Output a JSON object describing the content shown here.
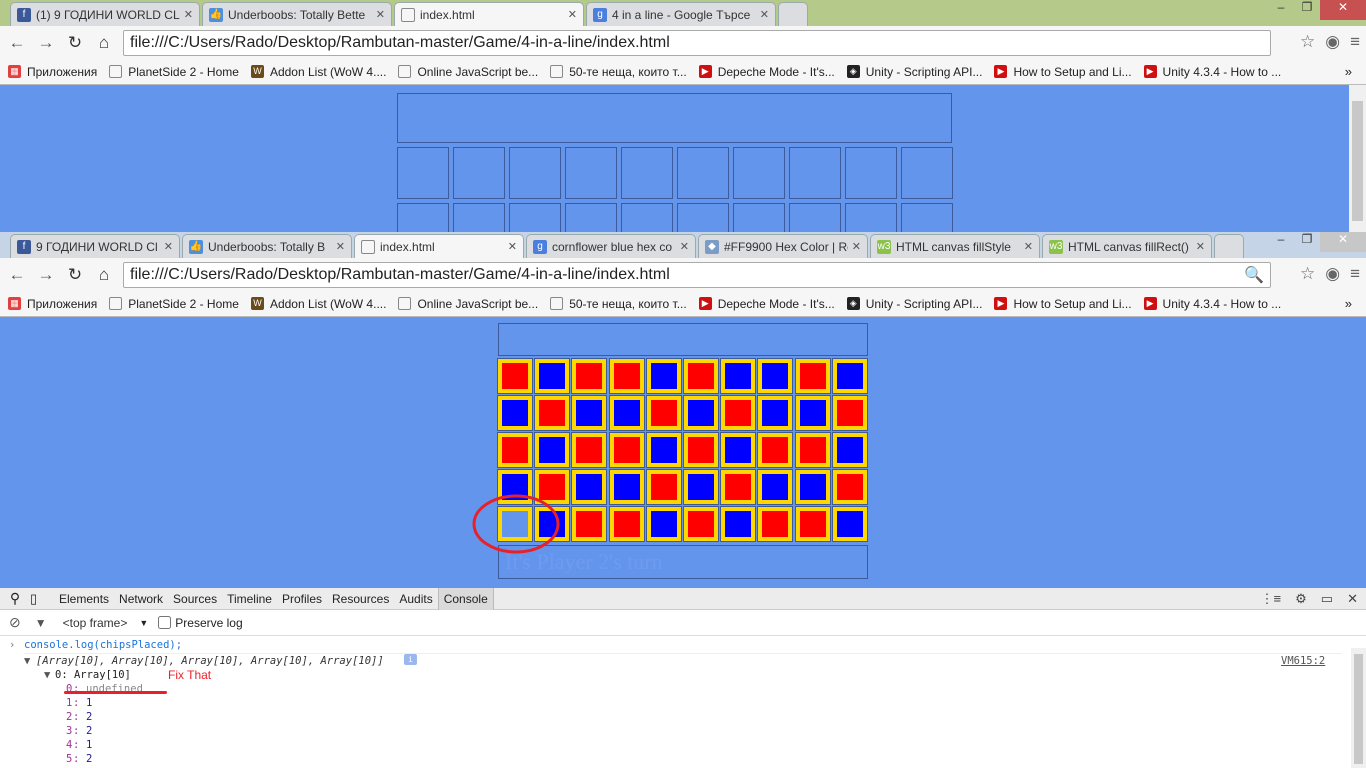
{
  "top_window": {
    "tabs": [
      {
        "label": "(1) 9 ГОДИНИ WORLD CL",
        "icon": "facebook-icon"
      },
      {
        "label": "Underboobs: Totally Bette",
        "icon": "thumbs-up-icon"
      },
      {
        "label": "index.html",
        "icon": "page-icon",
        "active": true
      },
      {
        "label": "4 in a line - Google Търсе",
        "icon": "google-icon"
      }
    ],
    "url": "file:///C:/Users/Rado/Desktop/Rambutan-master/Game/4-in-a-line/index.html"
  },
  "bottom_window": {
    "tabs": [
      {
        "label": "9 ГОДИНИ WORLD Cl",
        "icon": "facebook-icon"
      },
      {
        "label": "Underboobs: Totally B",
        "icon": "thumbs-up-icon"
      },
      {
        "label": "index.html",
        "icon": "page-icon",
        "active": true
      },
      {
        "label": "cornflower blue hex co",
        "icon": "google-icon"
      },
      {
        "label": "#FF9900 Hex Color | Rc",
        "icon": "paint-icon"
      },
      {
        "label": "HTML canvas fillStyle",
        "icon": "w3schools-icon"
      },
      {
        "label": "HTML canvas fillRect()",
        "icon": "w3schools-icon"
      }
    ],
    "url": "file:///C:/Users/Rado/Desktop/Rambutan-master/Game/4-in-a-line/index.html"
  },
  "bookmarks": [
    {
      "label": "Приложения",
      "icon": "apps-icon"
    },
    {
      "label": "PlanetSide 2 - Home",
      "icon": "page-icon"
    },
    {
      "label": "Addon List (WoW 4....",
      "icon": "wow-icon"
    },
    {
      "label": "Online JavaScript be...",
      "icon": "page-icon"
    },
    {
      "label": "50-те неща, които т...",
      "icon": "page-icon"
    },
    {
      "label": "Depeche Mode - It's...",
      "icon": "youtube-icon"
    },
    {
      "label": "Unity - Scripting API...",
      "icon": "unity-icon"
    },
    {
      "label": "How to Setup and Li...",
      "icon": "youtube-icon"
    },
    {
      "label": "Unity 4.3.4 - How to ...",
      "icon": "youtube-icon"
    }
  ],
  "game": {
    "status": "It's Player 2's turn",
    "board": [
      [
        "R",
        "B",
        "R",
        "R",
        "B",
        "R",
        "B",
        "B",
        "R",
        "B"
      ],
      [
        "B",
        "R",
        "B",
        "B",
        "R",
        "B",
        "R",
        "B",
        "B",
        "R"
      ],
      [
        "R",
        "B",
        "R",
        "R",
        "B",
        "R",
        "B",
        "R",
        "R",
        "B"
      ],
      [
        "B",
        "R",
        "B",
        "B",
        "R",
        "B",
        "R",
        "B",
        "B",
        "R"
      ],
      [
        "E",
        "B",
        "R",
        "R",
        "B",
        "R",
        "B",
        "R",
        "R",
        "B"
      ]
    ],
    "colors": {
      "R": "#FF0000",
      "B": "#0000FF",
      "E": "#6495ED",
      "border": "#FFD700",
      "background": "#6495ED"
    }
  },
  "devtools": {
    "tabs": [
      "Elements",
      "Network",
      "Sources",
      "Timeline",
      "Profiles",
      "Resources",
      "Audits",
      "Console"
    ],
    "active_tab": "Console",
    "frame": "<top frame>",
    "preserve_log": "Preserve log",
    "command": "console.log(chipsPlaced);",
    "result_summary": "[Array[10], Array[10], Array[10], Array[10], Array[10]]",
    "source_link": "VM615:2",
    "expanded": "0: Array[10]",
    "entries": [
      {
        "k": "0",
        "v": "undefined"
      },
      {
        "k": "1",
        "v": "1"
      },
      {
        "k": "2",
        "v": "2"
      },
      {
        "k": "3",
        "v": "2"
      },
      {
        "k": "4",
        "v": "1"
      },
      {
        "k": "5",
        "v": "2"
      }
    ],
    "annotation": "Fix That"
  }
}
